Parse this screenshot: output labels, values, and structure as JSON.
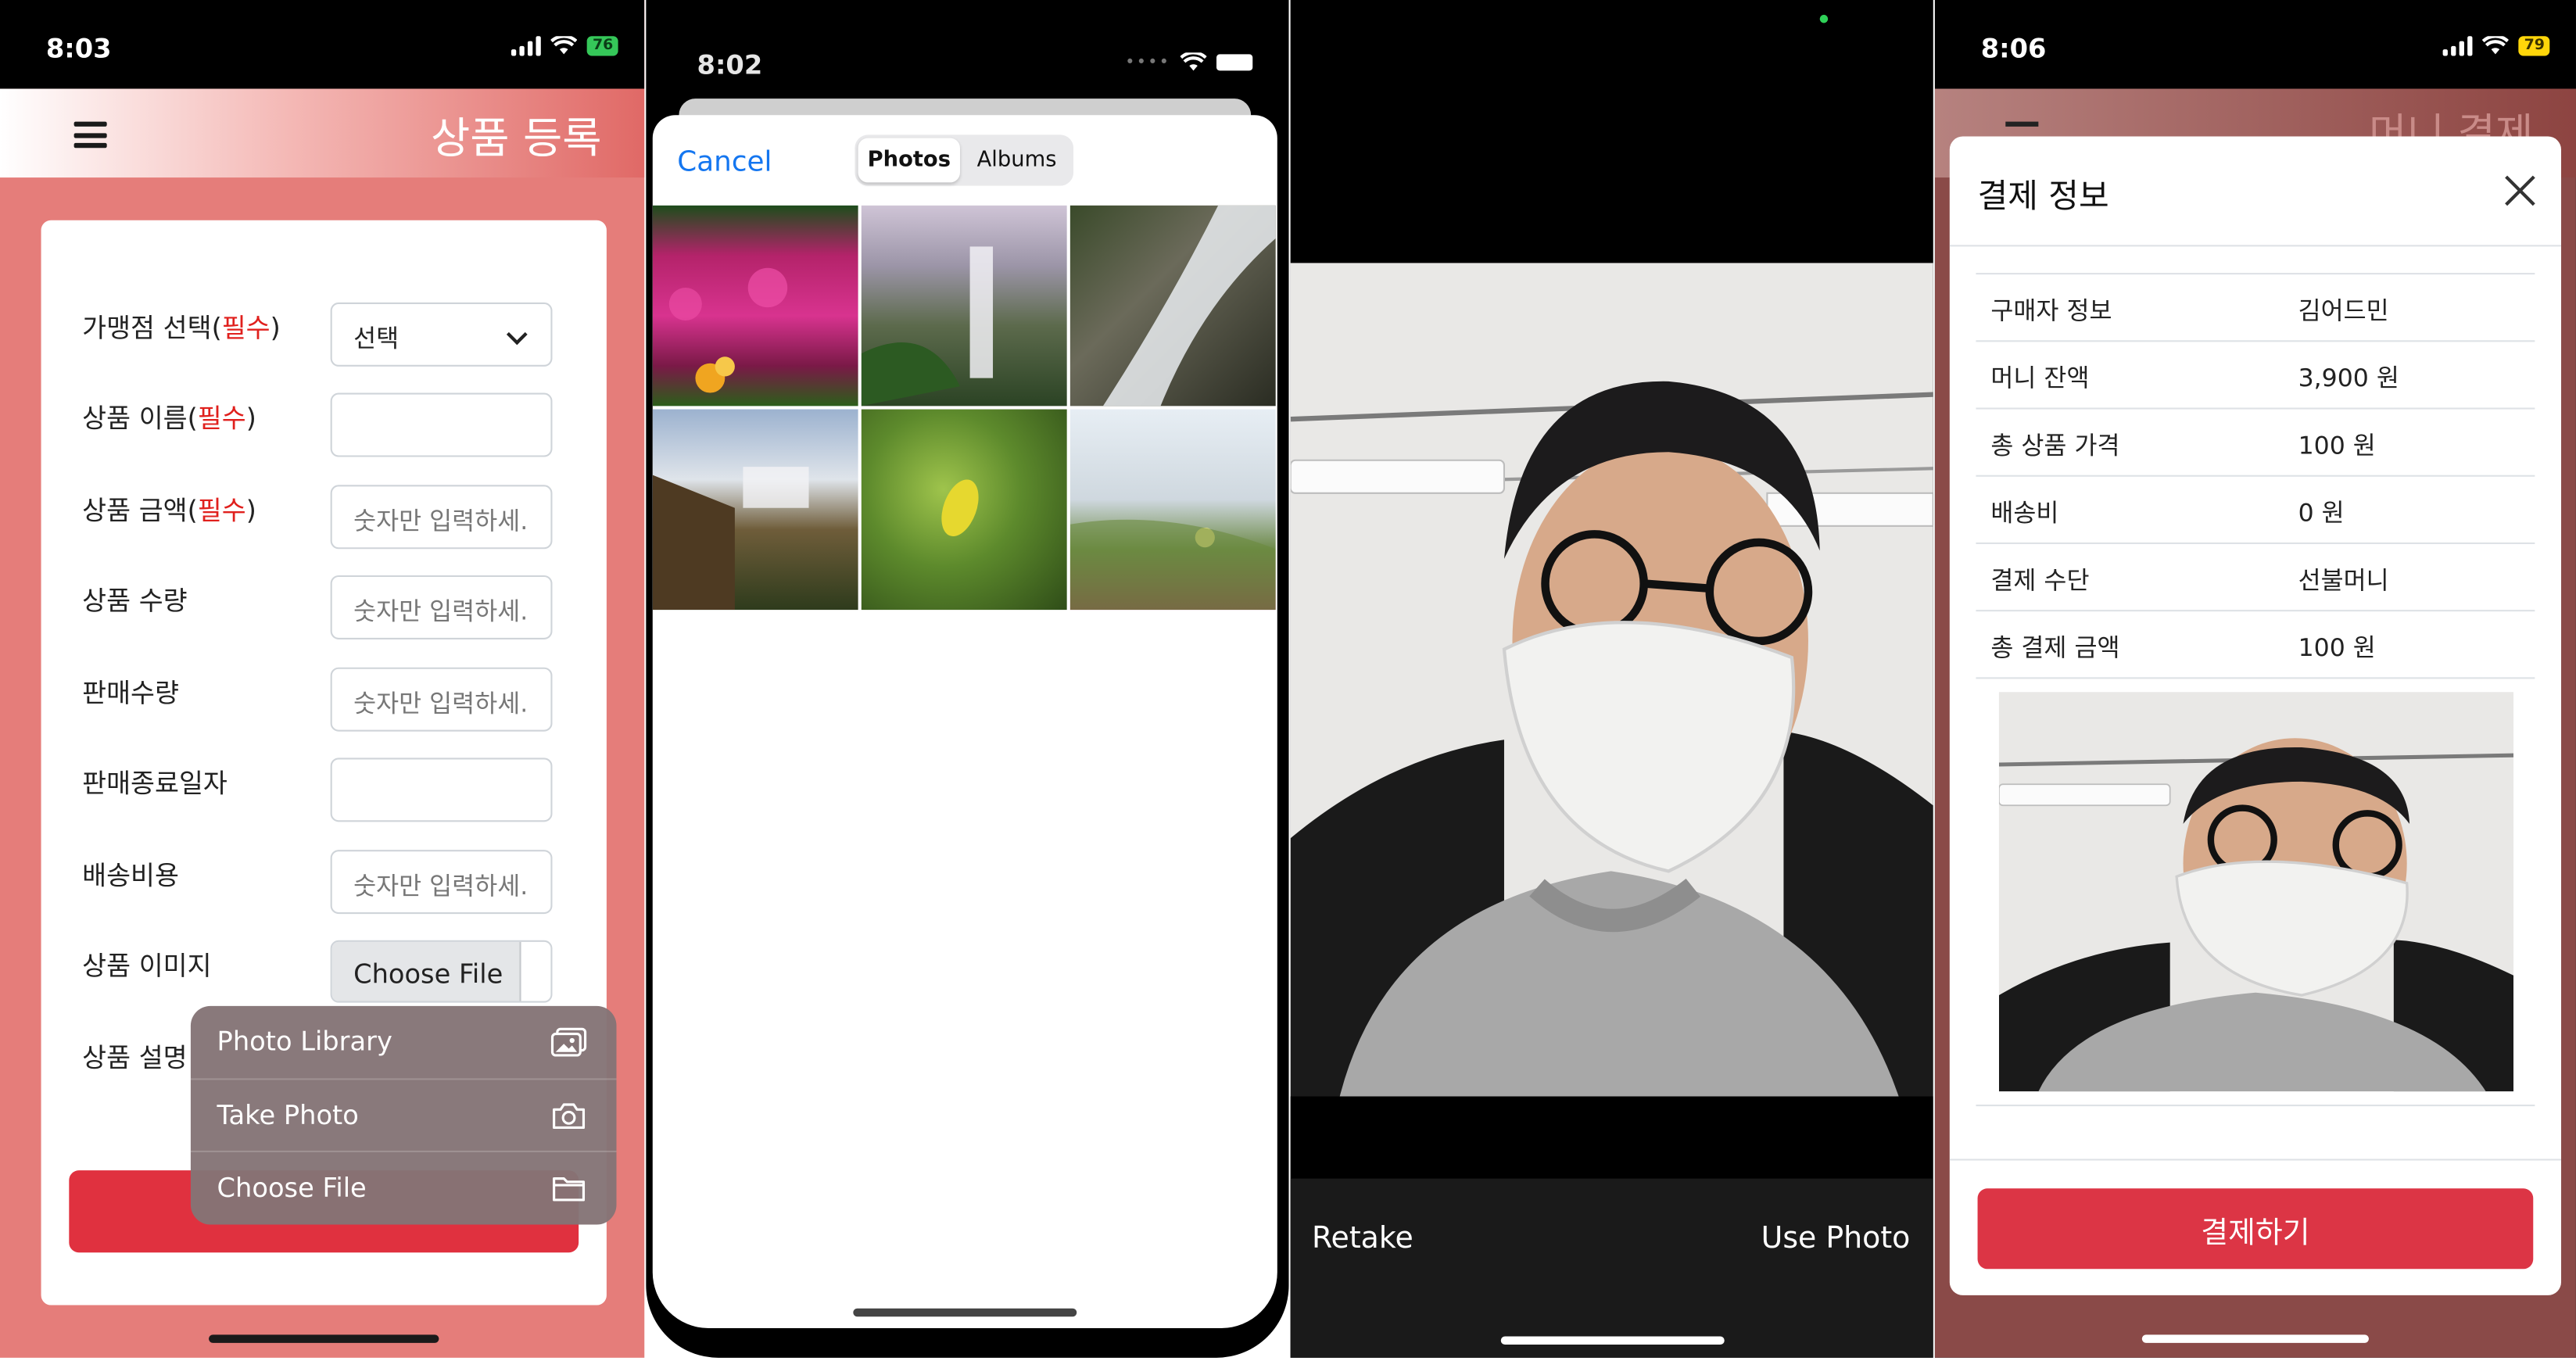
{
  "colors": {
    "accent_red": "#e0313f",
    "required_red": "#e0201d",
    "ios_blue": "#1476f0",
    "pay_red": "#dc3545"
  },
  "panel1": {
    "status": {
      "time": "8:03",
      "battery": "76"
    },
    "header": {
      "menu_icon": "hamburger-icon",
      "title": "상품 등록"
    },
    "form": {
      "rows": [
        {
          "label": "가맹점 선택(",
          "req": "필수",
          "close": ")",
          "type": "select",
          "value": "선택"
        },
        {
          "label": "상품 이름(",
          "req": "필수",
          "close": ")",
          "type": "text",
          "placeholder": ""
        },
        {
          "label": "상품 금액(",
          "req": "필수",
          "close": ")",
          "type": "text",
          "placeholder": "숫자만 입력하세."
        },
        {
          "label": "상품 수량",
          "type": "text",
          "placeholder": "숫자만 입력하세."
        },
        {
          "label": "판매수량",
          "type": "text",
          "placeholder": "숫자만 입력하세."
        },
        {
          "label": "판매종료일자",
          "type": "text",
          "placeholder": ""
        },
        {
          "label": "배송비용",
          "type": "text",
          "placeholder": "숫자만 입력하세."
        },
        {
          "label": "상품 이미지",
          "type": "file",
          "button": "Choose File"
        },
        {
          "label": "상품 설명"
        }
      ]
    },
    "popup": [
      {
        "label": "Photo Library",
        "icon": "photo-library-icon"
      },
      {
        "label": "Take Photo",
        "icon": "camera-icon"
      },
      {
        "label": "Choose File",
        "icon": "folder-icon"
      }
    ]
  },
  "panel2": {
    "status": {
      "time": "8:02"
    },
    "cancel": "Cancel",
    "tabs": {
      "photos": "Photos",
      "albums": "Albums"
    }
  },
  "panel3": {
    "retake": "Retake",
    "use_photo": "Use Photo"
  },
  "panel4": {
    "status": {
      "time": "8:06",
      "battery": "79"
    },
    "bg_title": "머니 결제",
    "modal_title": "결제 정보",
    "rows": [
      {
        "key": "구매자 정보",
        "value": "김어드민"
      },
      {
        "key": "머니 잔액",
        "value": "3,900 원"
      },
      {
        "key": "총 상품 가격",
        "value": "100 원"
      },
      {
        "key": "배송비",
        "value": "0 원"
      },
      {
        "key": "결제 수단",
        "value": "선불머니"
      },
      {
        "key": "총 결제 금액",
        "value": "100 원"
      }
    ],
    "pay_button": "결제하기"
  }
}
